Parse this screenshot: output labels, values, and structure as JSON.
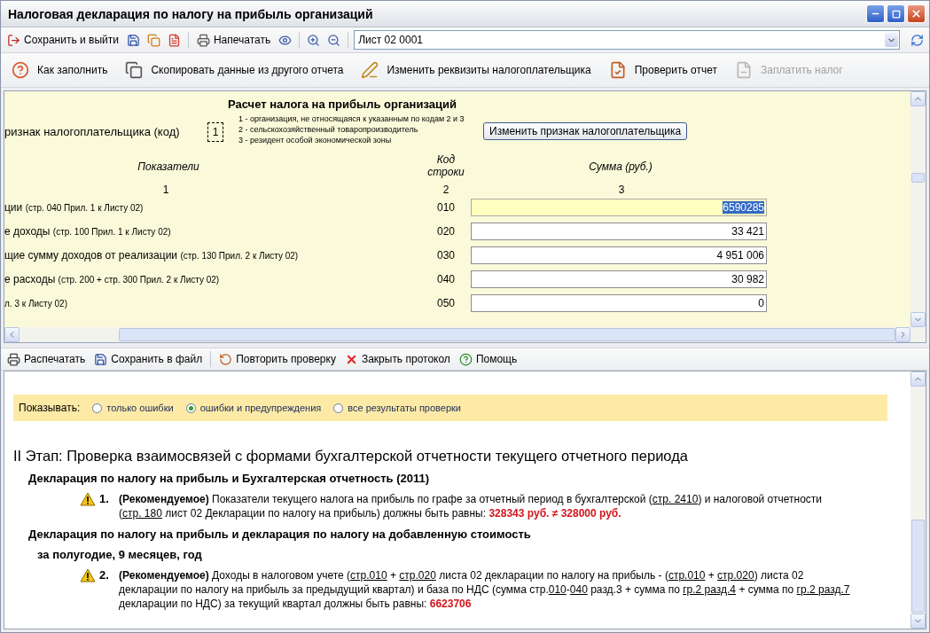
{
  "window": {
    "title": "Налоговая декларация по налогу на прибыль организаций"
  },
  "toolbar": {
    "save_exit": "Сохранить и выйти",
    "print": "Напечатать",
    "sheet": "Лист 02 0001"
  },
  "actions": [
    {
      "label": "Как заполнить",
      "disabled": false
    },
    {
      "label": "Скопировать данные из другого отчета",
      "disabled": false
    },
    {
      "label": "Изменить реквизиты налогоплательщика",
      "disabled": false
    },
    {
      "label": "Проверить отчет",
      "disabled": false
    },
    {
      "label": "Заплатить налог",
      "disabled": true
    }
  ],
  "form": {
    "title": "Расчет налога на прибыль организаций",
    "taxpayer_sign": {
      "label": "ризнак налогоплательщика (код)",
      "code": "1",
      "options": [
        "1 - организация, не относящаяся к указанным по кодам 2 и 3",
        "2 - сельскохозяйственный товаропроизводитель",
        "3 - резидент особой экономической зоны"
      ],
      "button": "Изменить признак налогоплательщика"
    },
    "headers": [
      "Показатели",
      "Код строки",
      "Сумма (руб.)"
    ],
    "numbers": [
      "1",
      "2",
      "3"
    ],
    "rows": [
      {
        "label": "ции",
        "ref": "(стр. 040 Прил. 1 к Листу 02)",
        "code": "010",
        "value": "6590285",
        "focused": true
      },
      {
        "label": "е доходы",
        "ref": "(стр. 100 Прил. 1 к Листу 02)",
        "code": "020",
        "value": "33 421",
        "focused": false
      },
      {
        "label": "щие сумму доходов от реализации",
        "ref": "(стр. 130 Прил. 2 к Листу 02)",
        "code": "030",
        "value": "4 951 006",
        "focused": false
      },
      {
        "label": "е расходы",
        "ref": "(стр. 200 + стр. 300 Прил. 2 к Листу 02)",
        "code": "040",
        "value": "30 982",
        "focused": false
      },
      {
        "label": "",
        "ref": "л. 3 к Листу 02)",
        "code": "050",
        "value": "0",
        "focused": false
      }
    ]
  },
  "protocol": {
    "toolbar": [
      "Распечатать",
      "Сохранить в файл",
      "Повторить проверку",
      "Закрыть протокол",
      "Помощь"
    ],
    "filter": {
      "label": "Показывать:",
      "options": [
        {
          "label": "только ошибки",
          "selected": false
        },
        {
          "label": "ошибки и предупреждения",
          "selected": true
        },
        {
          "label": "все результаты проверки",
          "selected": false
        }
      ]
    },
    "stage": "II Этап: Проверка взаимосвязей с формами бухгалтерской отчетности текущего отчетного периода",
    "groups": [
      {
        "title": "Декларация по налогу на прибыль и Бухгалтерская отчетность (2011)",
        "checks": [
          {
            "number": "1.",
            "segments": [
              {
                "kind": "bold",
                "text": "(Рекомендуемое)"
              },
              {
                "kind": "text",
                "text": " Показатели текущего налога на прибыль по графе за отчетный период в бухгалтерской ("
              },
              {
                "kind": "link",
                "text": "стр. 2410"
              },
              {
                "kind": "text",
                "text": ") и налоговой отчетности ("
              },
              {
                "kind": "link",
                "text": "стр. 180"
              },
              {
                "kind": "text",
                "text": " лист 02 Декларации по налогу на прибыль) должны быть равны: "
              },
              {
                "kind": "value",
                "text": "328343 руб. ≠ 328000 руб."
              }
            ]
          }
        ]
      },
      {
        "title": "Декларация по налогу на прибыль и декларация по налогу на добавленную стоимость",
        "subtitle": "за полугодие, 9 месяцев, год",
        "checks": [
          {
            "number": "2.",
            "segments": [
              {
                "kind": "bold",
                "text": "(Рекомендуемое)"
              },
              {
                "kind": "text",
                "text": " Доходы в налоговом учете ("
              },
              {
                "kind": "link",
                "text": "стр.010"
              },
              {
                "kind": "text",
                "text": " + "
              },
              {
                "kind": "link",
                "text": "стр.020"
              },
              {
                "kind": "text",
                "text": " листа 02 декларации по налогу на прибыль - ("
              },
              {
                "kind": "link",
                "text": "стр.010"
              },
              {
                "kind": "text",
                "text": " + "
              },
              {
                "kind": "link",
                "text": "стр.020"
              },
              {
                "kind": "text",
                "text": ") листа 02 декларации по налогу на прибыль за предыдущий квартал) и база по НДС (сумма стр."
              },
              {
                "kind": "link",
                "text": "010"
              },
              {
                "kind": "text",
                "text": "-"
              },
              {
                "kind": "link",
                "text": "040"
              },
              {
                "kind": "text",
                "text": " разд.3 + сумма по "
              },
              {
                "kind": "link",
                "text": "гр.2 разд.4"
              },
              {
                "kind": "text",
                "text": " + сумма по "
              },
              {
                "kind": "link",
                "text": "гр.2 разд.7"
              },
              {
                "kind": "text",
                "text": " декларации по НДС) за текущий квартал должны быть равны: "
              },
              {
                "kind": "value",
                "text": "6623706"
              }
            ]
          }
        ]
      }
    ]
  }
}
